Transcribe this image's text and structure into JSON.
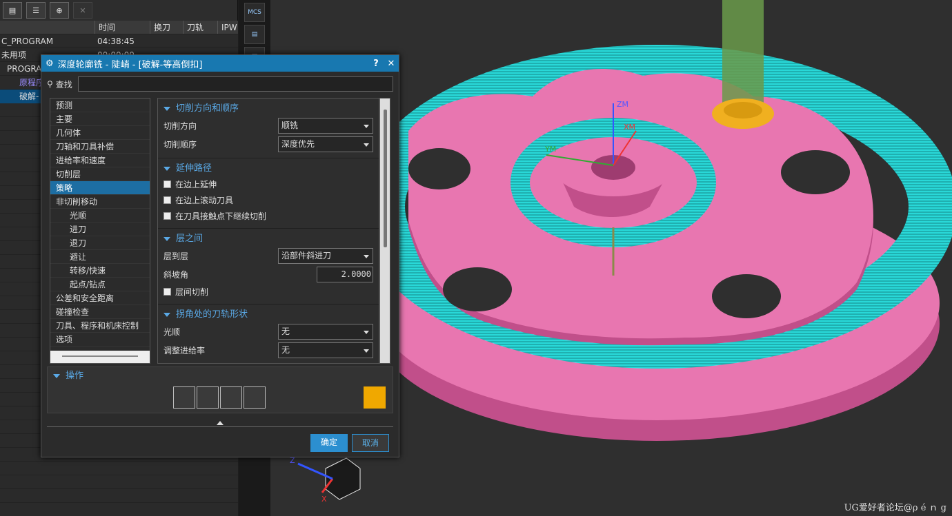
{
  "navigator": {
    "columns": [
      "时间",
      "换刀",
      "刀轨",
      "IPW"
    ],
    "rows": [
      {
        "name": "C_PROGRAM",
        "time": "04:38:45"
      },
      {
        "name": "未用项",
        "time": "00:00:00"
      },
      {
        "name": "PROGRA",
        "time": ""
      },
      {
        "name": "原程序",
        "time": ""
      },
      {
        "name": "破解-",
        "time": ""
      }
    ]
  },
  "strip": {
    "mcs_label": "MCS"
  },
  "dialog": {
    "title": "深度轮廓铣 - 陡峭 - [破解-等高倒扣]",
    "help": "?",
    "close": "✕",
    "search_label": "查找",
    "tree": [
      "预测",
      "主要",
      "几何体",
      "刀轴和刀具补偿",
      "进给率和速度",
      "切削层",
      "策略",
      "非切削移动",
      "光顺",
      "进刀",
      "退刀",
      "避让",
      "转移/快速",
      "起点/钻点",
      "公差和安全距离",
      "碰撞检查",
      "刀具、程序和机床控制",
      "选项"
    ],
    "sections": {
      "cut": {
        "title": "切削方向和顺序",
        "dir_label": "切削方向",
        "dir_value": "顺铣",
        "order_label": "切削顺序",
        "order_value": "深度优先"
      },
      "ext": {
        "title": "延伸路径",
        "c1": "在边上延伸",
        "c2": "在边上滚动刀具",
        "c3": "在刀具接触点下继续切削"
      },
      "layers": {
        "title": "层之间",
        "l2l_label": "层到层",
        "l2l_value": "沿部件斜进刀",
        "ramp_label": "斜坡角",
        "ramp_value": "2.0000",
        "c1": "层间切削"
      },
      "corner": {
        "title": "拐角处的刀轨形状",
        "smooth_label": "光顺",
        "smooth_value": "无",
        "cut_label": "调整进给率",
        "cut_value": "无"
      }
    },
    "ops_title": "操作",
    "ok": "确定",
    "cancel": "取消"
  },
  "viewport": {
    "axis_zm": "ZM",
    "axis_xm": "XM",
    "axis_ym": "YM",
    "tri_z": "Z",
    "tri_x": "X"
  },
  "watermark": "UG爱好者论坛@ρ é ｎ g"
}
